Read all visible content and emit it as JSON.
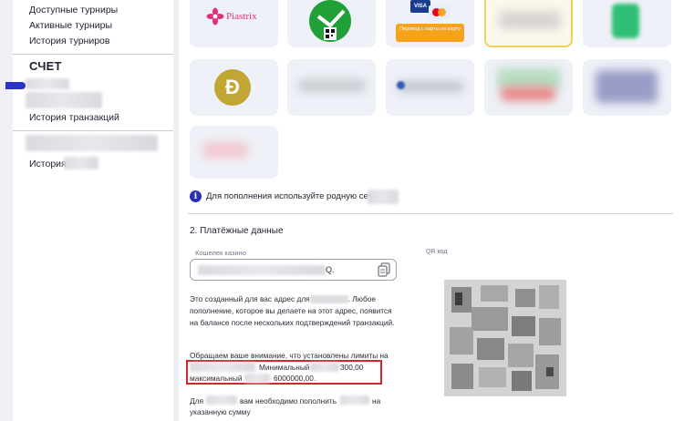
{
  "sidebar": {
    "links_top": [
      "Доступные турниры",
      "Активные турниры",
      "История турниров"
    ],
    "section_title": "СЧЕТ",
    "transactions": "История транзакций",
    "history_prefix": "История"
  },
  "payments": {
    "piastrix_label": "Piastrix",
    "card_transfer_text": "Перевод с карты на карту",
    "visa_text": "VISA",
    "info_text": "Для пополнения используйте родную сеть",
    "section_heading": "2. Платёжные данные",
    "wallet_label": "Кошелек казино",
    "wallet_value_tail": "Q.",
    "qr_label": "QR код",
    "address_note": [
      "Это созданный для вас адрес для",
      ". Любое пополнение, которое вы делаете на этот адрес, появится на балансе после нескольких подтверждений транзакций."
    ],
    "limits_intro": "Обращаем ваше внимание, что установлены лимиты на",
    "min_label": "Минимальный",
    "min_value": "300,00",
    "max_label": "максимальный",
    "max_value": "6000000,00.",
    "need_prefix": "Для",
    "need_middle": "вам необходимо пополнить",
    "need_suffix": "на",
    "need_line2": "указанную сумму"
  },
  "colors": {
    "accent": "#2c34c6",
    "highlight": "#d3272a",
    "selected_border": "#f1d15a",
    "sber_green": "#21a038",
    "doge_gold": "#c2a633"
  }
}
